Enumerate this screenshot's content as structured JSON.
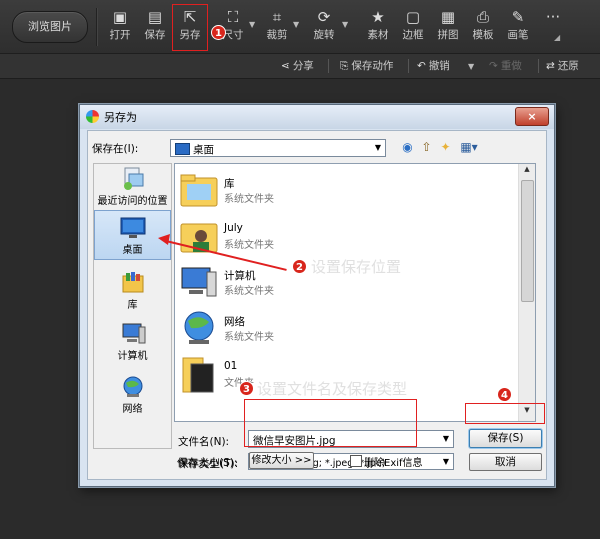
{
  "toolbar": {
    "browse_label": "浏览图片",
    "tools": [
      {
        "label": "打开",
        "icon": "open-icon"
      },
      {
        "label": "保存",
        "icon": "save-icon"
      },
      {
        "label": "另存",
        "icon": "save-as-icon"
      },
      {
        "label": "尺寸",
        "icon": "resize-icon"
      },
      {
        "label": "裁剪",
        "icon": "crop-icon"
      },
      {
        "label": "旋转",
        "icon": "rotate-icon"
      },
      {
        "label": "素材",
        "icon": "star-icon"
      },
      {
        "label": "边框",
        "icon": "frame-icon"
      },
      {
        "label": "拼图",
        "icon": "grid-icon"
      },
      {
        "label": "模板",
        "icon": "printer-icon"
      },
      {
        "label": "画笔",
        "icon": "brush-icon"
      }
    ],
    "more": "···"
  },
  "subbar": {
    "share": "分享",
    "save_action": "保存动作",
    "undo": "撤销",
    "redo": "重做",
    "restore": "还原"
  },
  "dialog": {
    "title": "另存为",
    "close": "×",
    "save_in_label": "保存在(I):",
    "save_in_value": "桌面",
    "places": [
      "最近访问的位置",
      "桌面",
      "库",
      "计算机",
      "网络"
    ],
    "files": [
      {
        "name": "库",
        "type": "系统文件夹"
      },
      {
        "name": "July",
        "type": "系统文件夹"
      },
      {
        "name": "计算机",
        "type": "系统文件夹"
      },
      {
        "name": "网络",
        "type": "系统文件夹"
      },
      {
        "name": "01",
        "type": "文件夹"
      }
    ],
    "filename_label": "文件名(N):",
    "filename_value": "微信早安图片.jpg",
    "filetype_label": "保存类型(T):",
    "filetype_value": "jpeg文件(*.jpg; *.jpeg; *.jpe)",
    "filesize_label": "保存大小(S):",
    "modify_size_button": "修改大小 >>",
    "delete_exif_label": "删除Exif信息",
    "delete_exif_checked": false,
    "save_button": "保存(S)",
    "cancel_button": "取消"
  },
  "annotations": {
    "step1": "1",
    "step2": "2",
    "step2_text": "设置保存位置",
    "step3": "3",
    "step3_text": "设置文件名及保存类型",
    "step4": "4"
  }
}
